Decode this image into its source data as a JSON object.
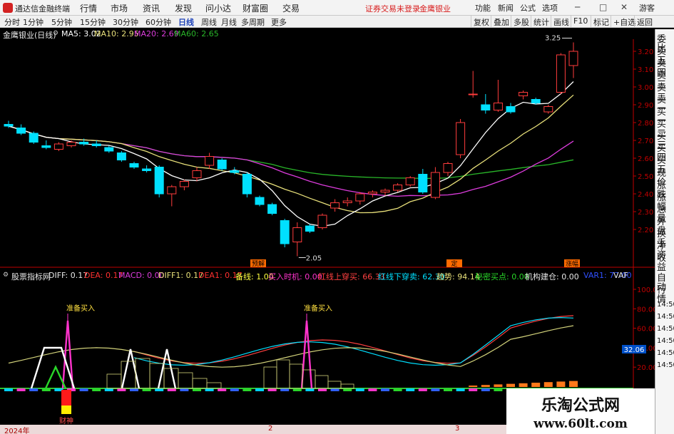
{
  "menubar": {
    "app_name": "通达信金融终端",
    "menus": [
      "行情",
      "市场",
      "资讯",
      "发现",
      "问小达",
      "财富圈",
      "交易"
    ],
    "warning": "证券交易未登录",
    "stock_label": "金鹰银业",
    "right_buttons": [
      "功能",
      "新闻",
      "公式",
      "选项"
    ],
    "window_controls": [
      "─",
      "□",
      "✕"
    ],
    "guest_label": "游客"
  },
  "tabbar": {
    "periods": [
      "分时",
      "1分钟",
      "5分钟",
      "15分钟",
      "30分钟",
      "60分钟",
      "日线",
      "周线",
      "月线",
      "多周期",
      "更多"
    ],
    "active_period": "日线",
    "tools": [
      "复权",
      "叠加",
      "多股",
      "统计",
      "画线",
      "F10",
      "标记",
      "+自选",
      "返回"
    ]
  },
  "main_info": {
    "title": "金鹰银业(日线)",
    "ma5": "MA5: 3.02",
    "ma10": "MA10: 2.95",
    "ma20": "MA20: 2.69",
    "ma60": "MA60: 2.65"
  },
  "colors": {
    "up": "#ff3c3c",
    "down": "#00e0ff",
    "ma5": "#ffffff",
    "ma10": "#e8e07a",
    "ma20": "#dd3cdd",
    "ma60": "#29b629",
    "axis": "#c00000",
    "diff": "#e0e0e0",
    "dea": "#ff3030",
    "line3": "#ff4040",
    "line4": "#00e0ff",
    "line5": "#d2d27a",
    "zero_band": "#2ec42e",
    "pink": "#ff33cc"
  },
  "price_axis": [
    "3.20",
    "3.10",
    "3.00",
    "2.90",
    "2.80",
    "2.70",
    "2.60",
    "2.50",
    "2.40",
    "2.30",
    "2.20"
  ],
  "annotations": {
    "high": "3.25",
    "low": "2.05",
    "signal_bottom": "预解",
    "signal_mid": "定",
    "signal_top": "涨幅"
  },
  "candles": [
    {
      "o": 2.79,
      "h": 2.81,
      "l": 2.77,
      "c": 2.78
    },
    {
      "o": 2.77,
      "h": 2.79,
      "l": 2.73,
      "c": 2.74
    },
    {
      "o": 2.74,
      "h": 2.75,
      "l": 2.68,
      "c": 2.69
    },
    {
      "o": 2.67,
      "h": 2.7,
      "l": 2.65,
      "c": 2.66
    },
    {
      "o": 2.65,
      "h": 2.69,
      "l": 2.64,
      "c": 2.68
    },
    {
      "o": 2.67,
      "h": 2.7,
      "l": 2.66,
      "c": 2.69
    },
    {
      "o": 2.69,
      "h": 2.71,
      "l": 2.67,
      "c": 2.68
    },
    {
      "o": 2.68,
      "h": 2.7,
      "l": 2.66,
      "c": 2.67
    },
    {
      "o": 2.66,
      "h": 2.67,
      "l": 2.63,
      "c": 2.64
    },
    {
      "o": 2.63,
      "h": 2.64,
      "l": 2.58,
      "c": 2.59
    },
    {
      "o": 2.57,
      "h": 2.58,
      "l": 2.54,
      "c": 2.55
    },
    {
      "o": 2.54,
      "h": 2.56,
      "l": 2.52,
      "c": 2.53
    },
    {
      "o": 2.55,
      "h": 2.56,
      "l": 2.38,
      "c": 2.4
    },
    {
      "o": 2.4,
      "h": 2.45,
      "l": 2.33,
      "c": 2.44
    },
    {
      "o": 2.44,
      "h": 2.48,
      "l": 2.42,
      "c": 2.47
    },
    {
      "o": 2.49,
      "h": 2.55,
      "l": 2.47,
      "c": 2.53
    },
    {
      "o": 2.56,
      "h": 2.63,
      "l": 2.54,
      "c": 2.61
    },
    {
      "o": 2.59,
      "h": 2.6,
      "l": 2.53,
      "c": 2.54
    },
    {
      "o": 2.53,
      "h": 2.55,
      "l": 2.51,
      "c": 2.52
    },
    {
      "o": 2.51,
      "h": 2.52,
      "l": 2.38,
      "c": 2.4
    },
    {
      "o": 2.38,
      "h": 2.39,
      "l": 2.33,
      "c": 2.34
    },
    {
      "o": 2.34,
      "h": 2.35,
      "l": 2.28,
      "c": 2.29
    },
    {
      "o": 2.25,
      "h": 2.26,
      "l": 2.1,
      "c": 2.12
    },
    {
      "o": 2.13,
      "h": 2.24,
      "l": 2.05,
      "c": 2.21
    },
    {
      "o": 2.22,
      "h": 2.23,
      "l": 2.18,
      "c": 2.19
    },
    {
      "o": 2.21,
      "h": 2.29,
      "l": 2.2,
      "c": 2.28
    },
    {
      "o": 2.32,
      "h": 2.37,
      "l": 2.3,
      "c": 2.35
    },
    {
      "o": 2.35,
      "h": 2.38,
      "l": 2.33,
      "c": 2.36
    },
    {
      "o": 2.36,
      "h": 2.41,
      "l": 2.34,
      "c": 2.4
    },
    {
      "o": 2.4,
      "h": 2.42,
      "l": 2.38,
      "c": 2.41
    },
    {
      "o": 2.41,
      "h": 2.43,
      "l": 2.39,
      "c": 2.42
    },
    {
      "o": 2.42,
      "h": 2.46,
      "l": 2.41,
      "c": 2.45
    },
    {
      "o": 2.45,
      "h": 2.5,
      "l": 2.44,
      "c": 2.49
    },
    {
      "o": 2.51,
      "h": 2.54,
      "l": 2.4,
      "c": 2.41
    },
    {
      "o": 2.38,
      "h": 2.55,
      "l": 2.37,
      "c": 2.52
    },
    {
      "o": 2.52,
      "h": 2.58,
      "l": 2.5,
      "c": 2.57
    },
    {
      "o": 2.62,
      "h": 2.82,
      "l": 2.6,
      "c": 2.8
    },
    {
      "o": 2.96,
      "h": 3.09,
      "l": 2.94,
      "c": 2.96
    },
    {
      "o": 2.9,
      "h": 2.96,
      "l": 2.85,
      "c": 2.87
    },
    {
      "o": 2.87,
      "h": 3.04,
      "l": 2.86,
      "c": 2.91
    },
    {
      "o": 2.89,
      "h": 2.91,
      "l": 2.85,
      "c": 2.86
    },
    {
      "o": 2.95,
      "h": 2.98,
      "l": 2.93,
      "c": 2.97
    },
    {
      "o": 2.93,
      "h": 2.94,
      "l": 2.9,
      "c": 2.91
    },
    {
      "o": 2.86,
      "h": 2.9,
      "l": 2.85,
      "c": 2.89
    },
    {
      "o": 2.97,
      "h": 3.19,
      "l": 2.96,
      "c": 3.18
    },
    {
      "o": 3.12,
      "h": 3.25,
      "l": 3.05,
      "c": 3.2
    }
  ],
  "sub_info": {
    "title": "股票指标网",
    "diff": "DIFF: 0.17",
    "dea": "DEA: 0.17",
    "macd": "MACD: 0.00",
    "diff1": "DIFF1: 0.17",
    "dea1": "DEA1: 0.17",
    "beixian": "备线: 1.00",
    "buy_time": "买入时机: 0.00",
    "red_cross": "红线上穿买: 66.33",
    "red_under": "红线下穿卖: 62.30",
    "trend": "趋势: 94.14",
    "secret": "秘密买点: 0.00",
    "inst": "机构建仓: 0.00",
    "var": "VAR1: 77.00",
    "var2": "VAF"
  },
  "sub_axis": [
    "100.0",
    "80.00",
    "60.00",
    "40.00",
    "20.00"
  ],
  "sub_value_badge": "32.06",
  "sub_labels": {
    "prepare_buy_1": "准备买入",
    "prepare_buy_2": "准备买入",
    "caifu": "财神"
  },
  "sidepanel": [
    "委比",
    "卖五",
    "卖四",
    "卖三",
    "卖二",
    "卖一",
    "买一",
    "买二",
    "买三",
    "买四",
    "买五",
    "现价",
    "涨跌",
    "涨幅",
    "总量",
    "外盘",
    "换手",
    "净资",
    "收益"
  ],
  "sidepanel_sub": [
    "自动",
    "行情",
    "14:50",
    "14:50",
    "14:50",
    "14:50",
    "14:50",
    "14:50"
  ],
  "bottombar": {
    "year": "2024年",
    "m2": "2",
    "m3": "3"
  },
  "watermark": {
    "title": "乐淘公式网",
    "url": "www.60lt.com"
  }
}
